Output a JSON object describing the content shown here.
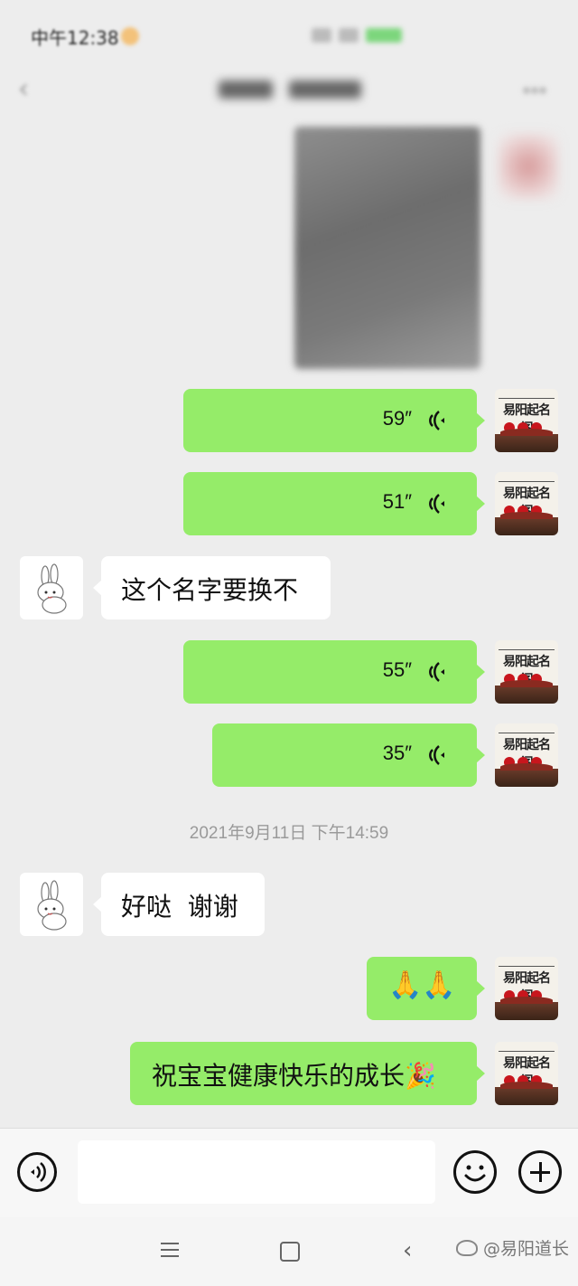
{
  "status_bar": {
    "time": "中午12:38"
  },
  "header": {
    "title": ""
  },
  "messages": [
    {
      "side": "right",
      "kind": "voice",
      "duration": "59″"
    },
    {
      "side": "right",
      "kind": "voice",
      "duration": "51″"
    },
    {
      "side": "left",
      "kind": "text",
      "text": "这个名字要换不"
    },
    {
      "side": "right",
      "kind": "voice",
      "duration": "55″"
    },
    {
      "side": "right",
      "kind": "voice",
      "duration": "35″"
    },
    {
      "side": "left",
      "kind": "text",
      "text": "好哒  谢谢"
    },
    {
      "side": "right",
      "kind": "emoji",
      "text": "🙏🙏"
    },
    {
      "side": "right",
      "kind": "text",
      "text": "祝宝宝健康快乐的成长🎉"
    }
  ],
  "timestamp": "2021年9月11日 下午14:59",
  "sender_avatar": {
    "title": "易阳起名阁",
    "icon": "name-studio-logo"
  },
  "contact_avatar": {
    "icon": "bunny-avatar"
  },
  "input": {
    "value": "",
    "placeholder": ""
  },
  "watermark": "@易阳道长",
  "colors": {
    "bubble_sent": "#95ec69",
    "bubble_received": "#ffffff",
    "background": "#ededed"
  }
}
